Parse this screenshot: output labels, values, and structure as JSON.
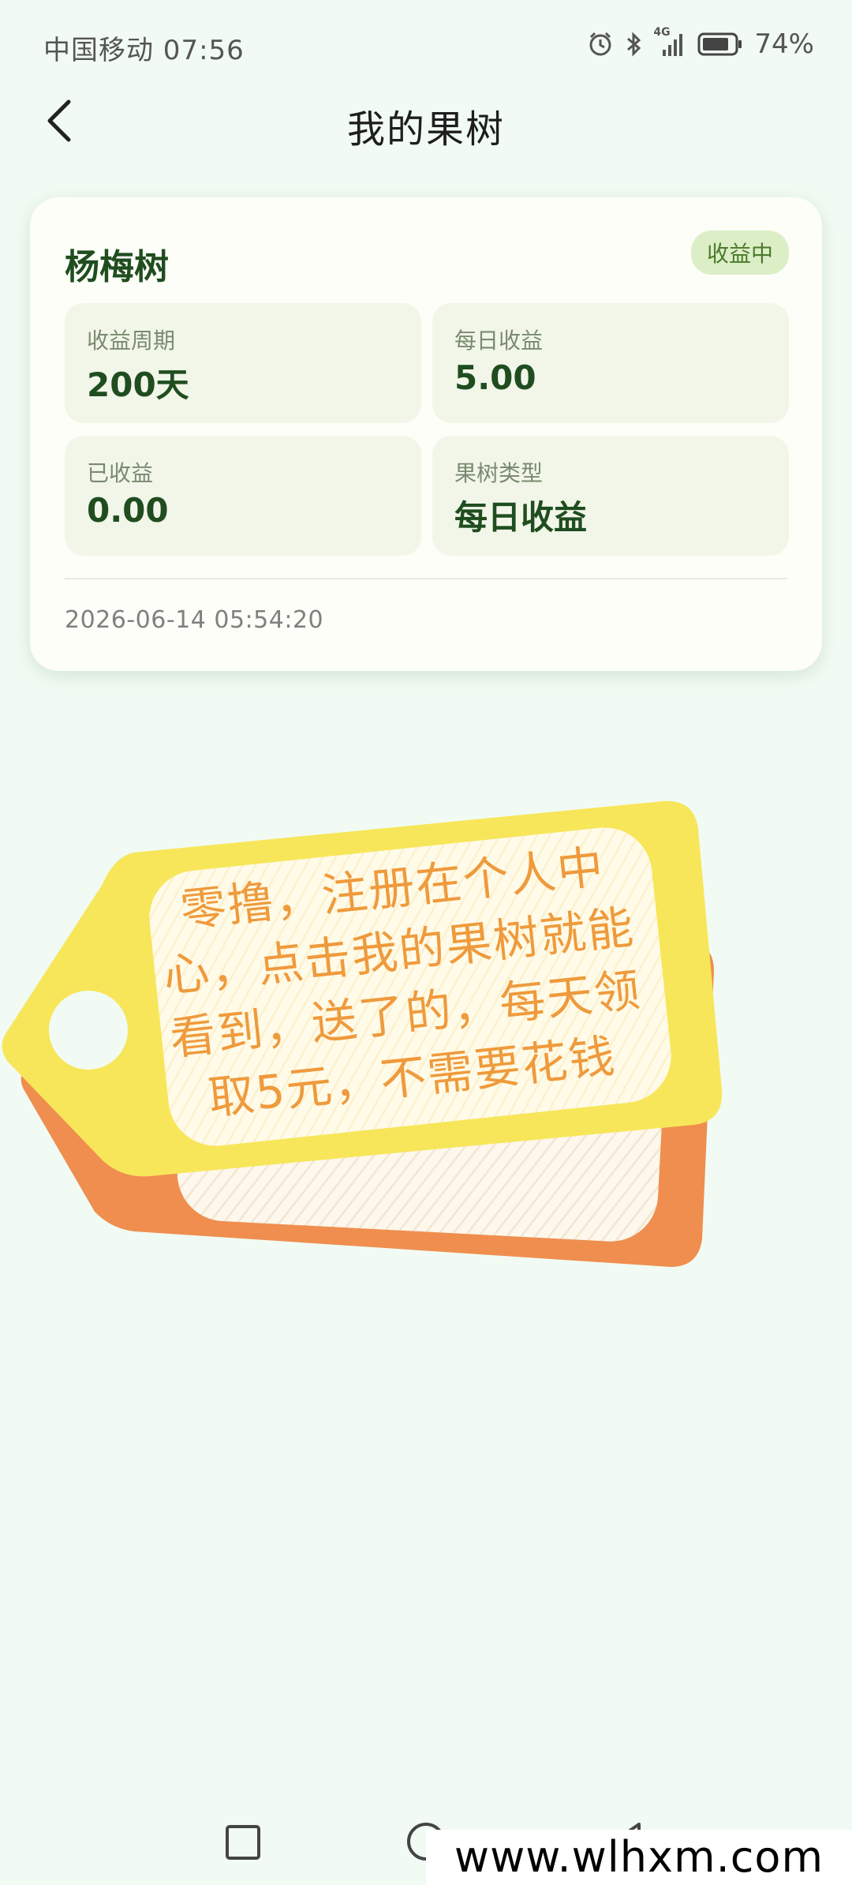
{
  "status_bar": {
    "carrier_time": "中国移动 07:56",
    "network": "4G",
    "battery": "74%",
    "icons": [
      "alarm-icon",
      "bluetooth-icon",
      "signal-icon",
      "battery-icon"
    ]
  },
  "header": {
    "title": "我的果树",
    "back_icon": "chevron-left-icon"
  },
  "card": {
    "tree_name": "杨梅树",
    "status": "收益中",
    "stats": [
      {
        "label": "收益周期",
        "value": "200天"
      },
      {
        "label": "每日收益",
        "value": "5.00"
      },
      {
        "label": "已收益",
        "value": "0.00"
      },
      {
        "label": "果树类型",
        "value": "每日收益"
      }
    ],
    "timestamp": "2026-06-14 05:54:20"
  },
  "promo": {
    "lines": [
      "零撸，注册在个人中",
      "心，点击我的果树就能",
      "看到，送了的，每天领",
      "取5元，不需要花钱"
    ],
    "colors": {
      "text": "#ef9a3c",
      "tag_front": "#f8e65a",
      "tag_back": "#ef8e4e"
    }
  },
  "nav_bar": {
    "buttons": [
      "recents-icon",
      "home-icon",
      "back-icon"
    ]
  },
  "watermark": {
    "text": "www.wlhxm.com"
  },
  "colors": {
    "background": "#f1fbf3",
    "card": "#fdfef8",
    "accent_green": "#1f4d1f",
    "badge_bg": "#dceec6"
  }
}
